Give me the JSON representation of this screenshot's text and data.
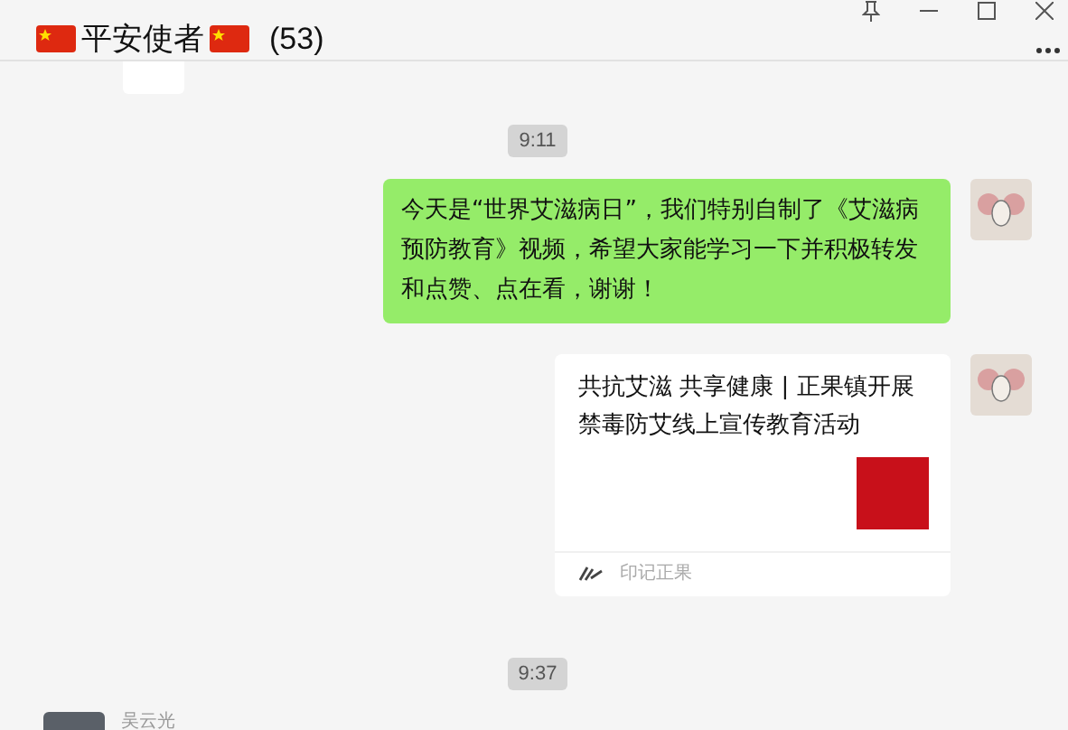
{
  "header": {
    "title": "平安使者",
    "count": "(53)"
  },
  "messages": [
    {
      "kind": "time",
      "text": "9:11"
    },
    {
      "kind": "text",
      "text": "今天是“世界艾滋病日”，我们特别自制了《艾滋病预防教育》视频，希望大家能学习一下并积极转发和点赞、点在看，谢谢！"
    },
    {
      "kind": "article",
      "title": "共抗艾滋 共享健康 | 正果镇开展禁毒防艾线上宣传教育活动",
      "source": "印记正果"
    },
    {
      "kind": "time",
      "text": "9:37"
    },
    {
      "kind": "incoming",
      "sender": "吴云光"
    }
  ]
}
